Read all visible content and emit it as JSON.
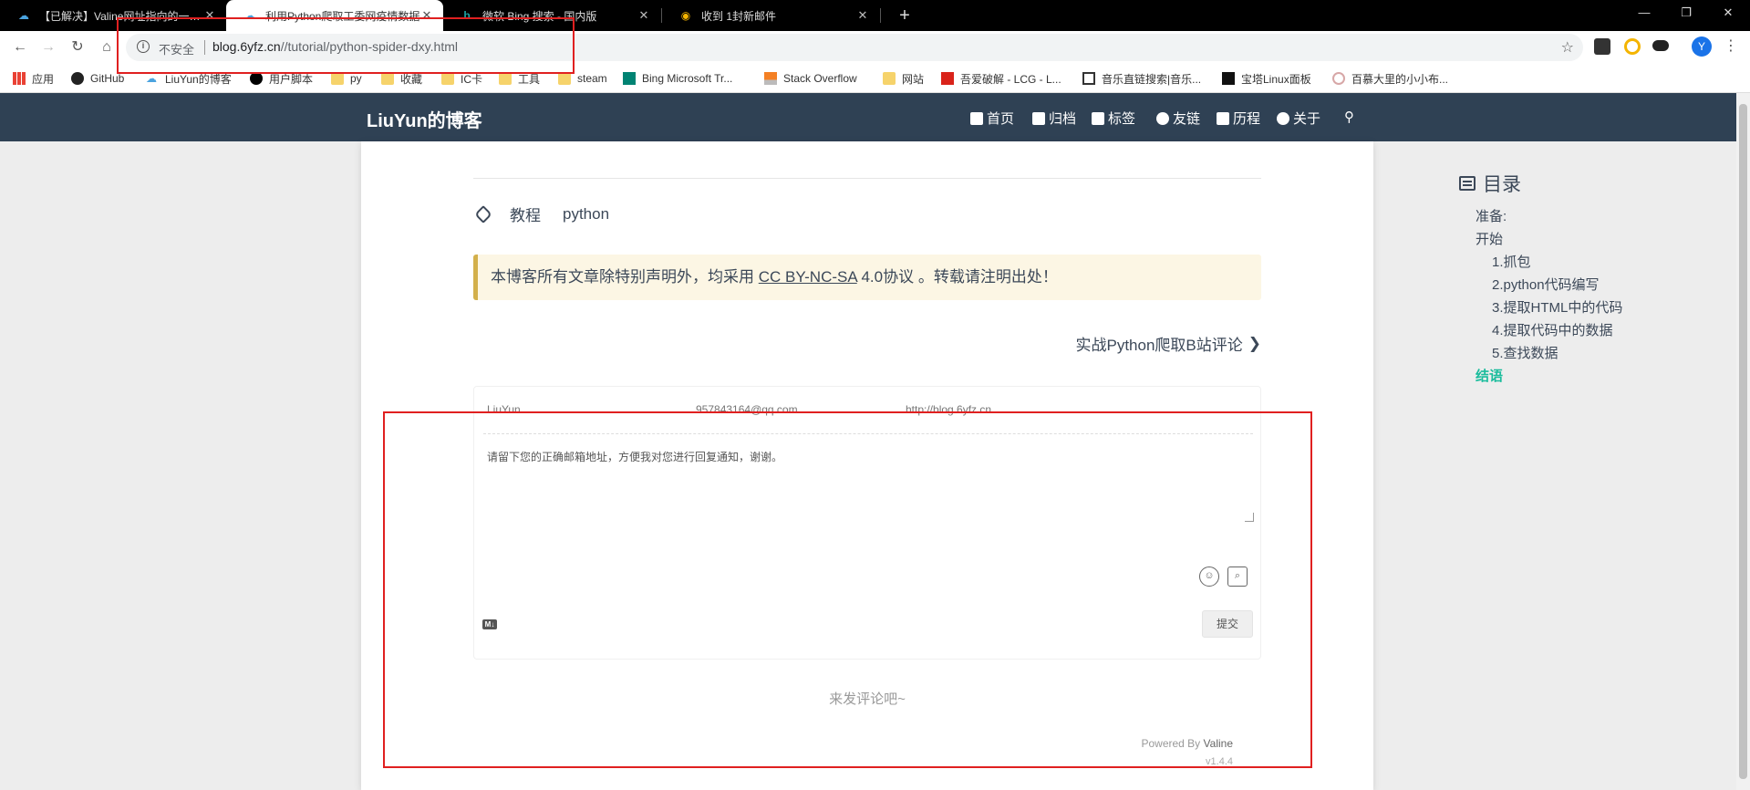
{
  "browser": {
    "tabs": [
      {
        "title": "【已解决】Valine网址指向的一…",
        "icon": "cloud-favicon"
      },
      {
        "title": "利用Python爬取工委网疫情数据",
        "icon": "cloud-favicon"
      },
      {
        "title": "微软 Bing 搜索 - 国内版",
        "icon": "bing-favicon"
      },
      {
        "title": "收到 1封新邮件",
        "icon": "mail-favicon"
      }
    ],
    "omnibox": {
      "security": "不安全",
      "url_domain": "blog.6yfz.cn",
      "url_path": "//tutorial/python-spider-dxy.html"
    },
    "profile_initial": "Y",
    "bookmarks": [
      {
        "label": "应用",
        "icon": "apps-grid-icon"
      },
      {
        "label": "GitHub",
        "icon": "github-icon"
      },
      {
        "label": "LiuYun的博客",
        "icon": "cloud-favicon"
      },
      {
        "label": "用户脚本",
        "icon": "userscript-icon"
      },
      {
        "label": "py",
        "icon": "folder-icon"
      },
      {
        "label": "收藏",
        "icon": "folder-icon"
      },
      {
        "label": "IC卡",
        "icon": "folder-icon"
      },
      {
        "label": "工具",
        "icon": "folder-icon"
      },
      {
        "label": "steam",
        "icon": "folder-icon"
      },
      {
        "label": "Bing Microsoft Tr...",
        "icon": "bing-icon"
      },
      {
        "label": "Stack Overflow",
        "icon": "stackoverflow-icon"
      },
      {
        "label": "网站",
        "icon": "folder-icon"
      },
      {
        "label": "吾爱破解 - LCG - L...",
        "icon": "52pojie-icon"
      },
      {
        "label": "音乐直链搜索|音乐...",
        "icon": "music-icon"
      },
      {
        "label": "宝塔Linux面板",
        "icon": "bt-icon"
      },
      {
        "label": "百慕大里的小小布...",
        "icon": "blog-icon"
      }
    ]
  },
  "site": {
    "brand": "LiuYun的博客",
    "nav": [
      {
        "label": "首页",
        "icon": "home-icon"
      },
      {
        "label": "归档",
        "icon": "archive-icon"
      },
      {
        "label": "标签",
        "icon": "tags-icon"
      },
      {
        "label": "友链",
        "icon": "link-icon"
      },
      {
        "label": "历程",
        "icon": "book-icon"
      },
      {
        "label": "关于",
        "icon": "user-icon"
      }
    ]
  },
  "post": {
    "tags": [
      "教程",
      "python"
    ],
    "notice_prefix": "本博客所有文章除特别声明外，均采用 ",
    "notice_link": "CC BY-NC-SA",
    "notice_suffix": " 4.0协议 。转载请注明出处！",
    "next_post": "实战Python爬取B站评论"
  },
  "comments": {
    "nick_placeholder": "LiuYun",
    "mail_placeholder": "957843164@qq.com",
    "link_placeholder": "http://blog.6yfz.cn",
    "textarea_placeholder": "请留下您的正确邮箱地址，方便我对您进行回复通知，谢谢。",
    "markdown_badge": "M↓",
    "submit_label": "提交",
    "empty_text": "来发评论吧~",
    "powered_prefix": "Powered By",
    "powered_name": "Valine",
    "version": "v1.4.4"
  },
  "toc": {
    "title": "目录",
    "items": [
      {
        "label": "准备:",
        "level": 1
      },
      {
        "label": "开始",
        "level": 1
      },
      {
        "label": "1.抓包",
        "level": 2
      },
      {
        "label": "2.python代码编写",
        "level": 2
      },
      {
        "label": "3.提取HTML中的代码",
        "level": 2
      },
      {
        "label": "4.提取代码中的数据",
        "level": 2
      },
      {
        "label": "5.查找数据",
        "level": 2
      },
      {
        "label": "结语",
        "level": 1,
        "active": true
      }
    ]
  },
  "colors": {
    "header_bg": "#2f4154",
    "toc_active": "#1abc9c",
    "annotation_red": "#e02020",
    "notice_bg": "#fcf6e4"
  }
}
